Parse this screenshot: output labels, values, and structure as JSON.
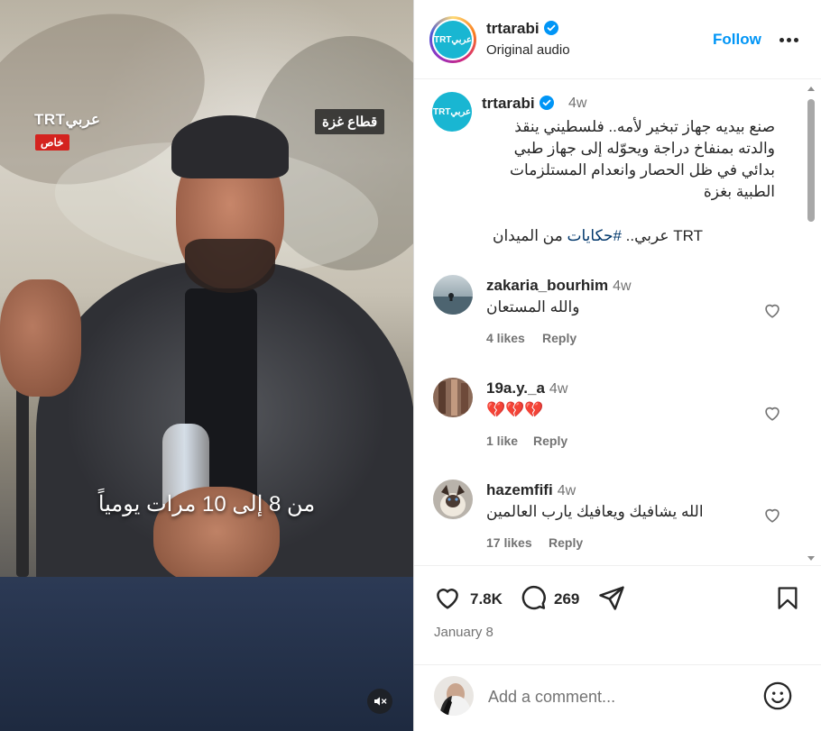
{
  "video": {
    "logo_text": "TRTعربي",
    "exclusive_badge": "خاص",
    "location_tag": "قطاع غزة",
    "subtitle": "من 8 إلى 10 مرات يومياً"
  },
  "header": {
    "username": "trtarabi",
    "avatar_text": "TRTعربي",
    "audio_label": "Original audio",
    "follow_label": "Follow"
  },
  "caption": {
    "username": "trtarabi",
    "time": "4w",
    "text": "صنع بيديه جهاز تبخير لأمه.. فلسطيني ينقذ والدته بمنفاخ دراجة ويحوّله إلى جهاز طبي بدائي في ظل الحصار وانعدام المستلزمات الطبية بغزة",
    "hashtag_prefix": "TRT عربي.. ",
    "hashtag": "#حكايات",
    "hashtag_suffix": " من الميدان"
  },
  "comments": [
    {
      "username": "zakaria_bourhim",
      "time": "4w",
      "text": "والله المستعان",
      "likes": "4 likes",
      "reply_label": "Reply"
    },
    {
      "username": "19a.y._a",
      "time": "4w",
      "text": "💔💔💔",
      "likes": "1 like",
      "reply_label": "Reply"
    },
    {
      "username": "hazemfifi",
      "time": "4w",
      "text": "الله يشافيك ويعافيك يارب العالمين",
      "likes": "17 likes",
      "reply_label": "Reply"
    }
  ],
  "actions": {
    "like_count": "7.8K",
    "comment_count": "269",
    "date": "January 8"
  },
  "add_comment": {
    "placeholder": "Add a comment..."
  },
  "colors": {
    "accent": "#0095f6",
    "trt_brand": "#19b6d2",
    "badge_red": "#d4231f"
  },
  "icons": {
    "verified": "verified-badge-icon",
    "more": "more-options-icon",
    "heart": "heart-icon",
    "comment": "comment-icon",
    "share": "share-icon",
    "save": "bookmark-icon",
    "emoji": "emoji-icon",
    "mute": "muted-speaker-icon"
  }
}
